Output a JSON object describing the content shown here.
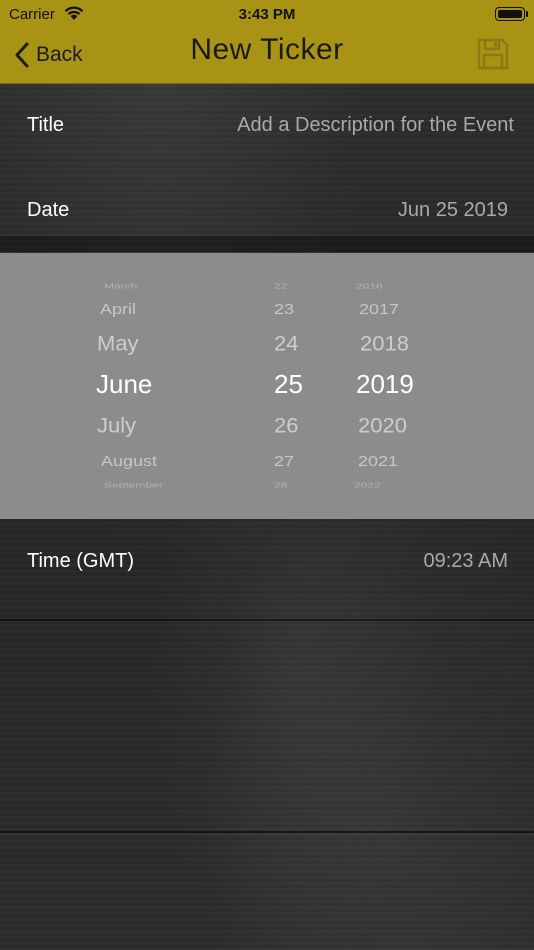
{
  "status_bar": {
    "carrier": "Carrier",
    "time": "3:43 PM"
  },
  "nav": {
    "back_label": "Back",
    "title": "New Ticker"
  },
  "form": {
    "title_label": "Title",
    "title_placeholder": "Add a Description for the Event",
    "date_label": "Date",
    "date_value": "Jun 25 2019",
    "time_label": "Time (GMT)",
    "time_value": "09:23 AM"
  },
  "picker": {
    "months": [
      "March",
      "April",
      "May",
      "June",
      "July",
      "August",
      "September"
    ],
    "days": [
      "22",
      "23",
      "24",
      "25",
      "26",
      "27",
      "28"
    ],
    "years": [
      "2016",
      "2017",
      "2018",
      "2019",
      "2020",
      "2021",
      "2022"
    ],
    "selected": {
      "month": "June",
      "day": "25",
      "year": "2019"
    }
  },
  "colors": {
    "bar": "#a99315",
    "picker_bg": "#8c8c8c",
    "value_text": "#a9a9a9"
  }
}
